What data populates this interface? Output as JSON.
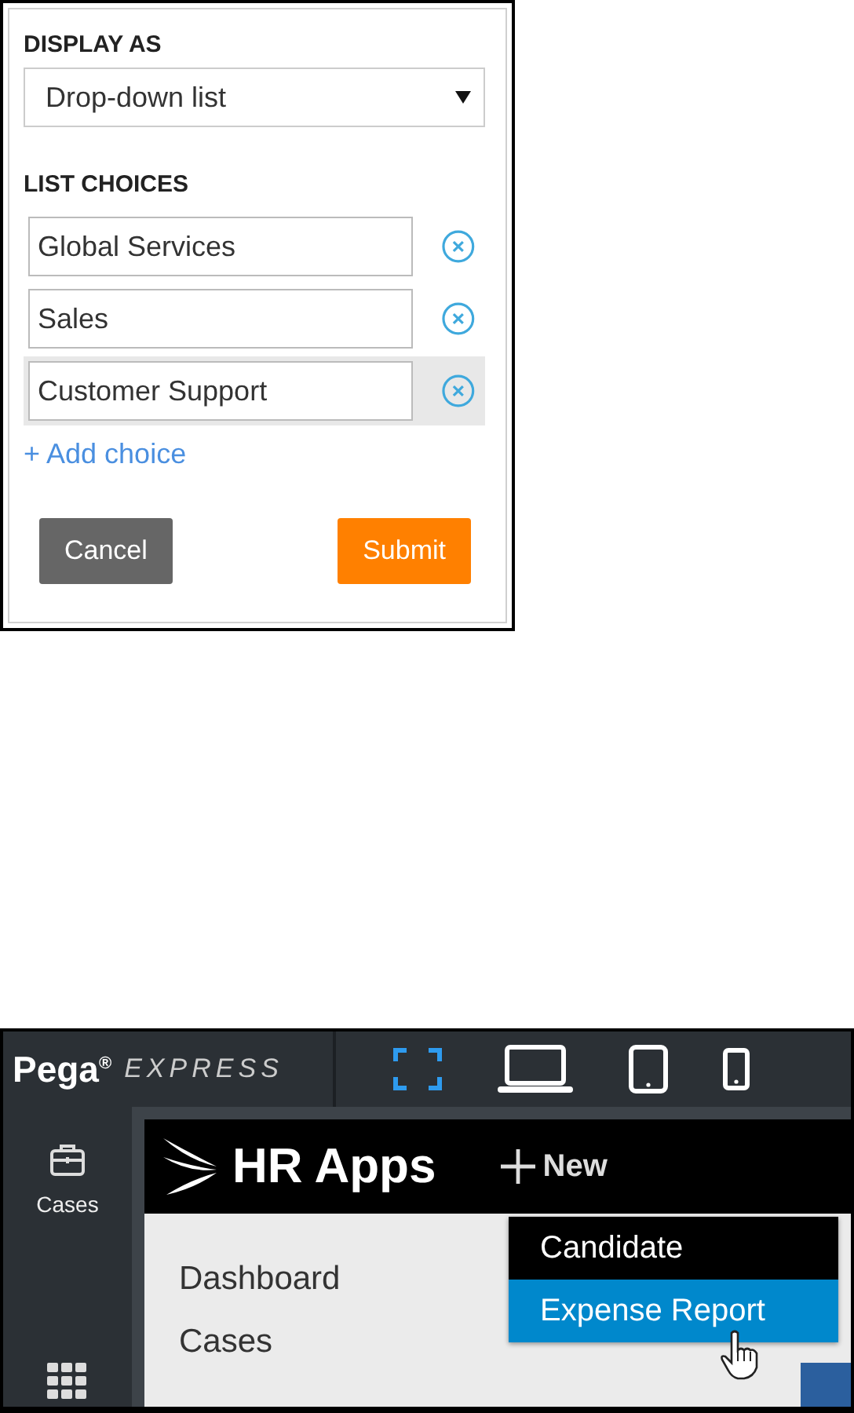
{
  "form": {
    "display_as": {
      "label": "DISPLAY AS",
      "value": "Drop-down list"
    },
    "list_choices": {
      "label": "LIST CHOICES",
      "choices": [
        {
          "value": "Global Services",
          "highlighted": false
        },
        {
          "value": "Sales",
          "highlighted": false
        },
        {
          "value": "Customer Support",
          "highlighted": true
        }
      ],
      "add_link": "+ Add choice"
    },
    "buttons": [
      {
        "label": "Cancel",
        "kind": "secondary"
      },
      {
        "label": "Submit",
        "kind": "primary"
      }
    ]
  },
  "app": {
    "brand": {
      "name": "Pega$^{®}$",
      "product": "EXPRESS"
    },
    "devices": [
      {
        "kind": "fullscreen",
        "selected": true
      },
      {
        "kind": "laptop",
        "selected": false
      },
      {
        "kind": "tablet",
        "selected": false
      },
      {
        "kind": "phone",
        "selected": false
      }
    ],
    "sidebar": [
      {
        "kind": "cases",
        "label": "Cases"
      },
      {
        "kind": "apps"
      }
    ],
    "header": {
      "title": "HR Apps",
      "new_button": "New"
    },
    "nav": [
      "Dashboard",
      "Cases"
    ],
    "new_menu": [
      {
        "label": "Candidate",
        "selected": false
      },
      {
        "label": "Expense Report",
        "selected": true
      }
    ]
  }
}
